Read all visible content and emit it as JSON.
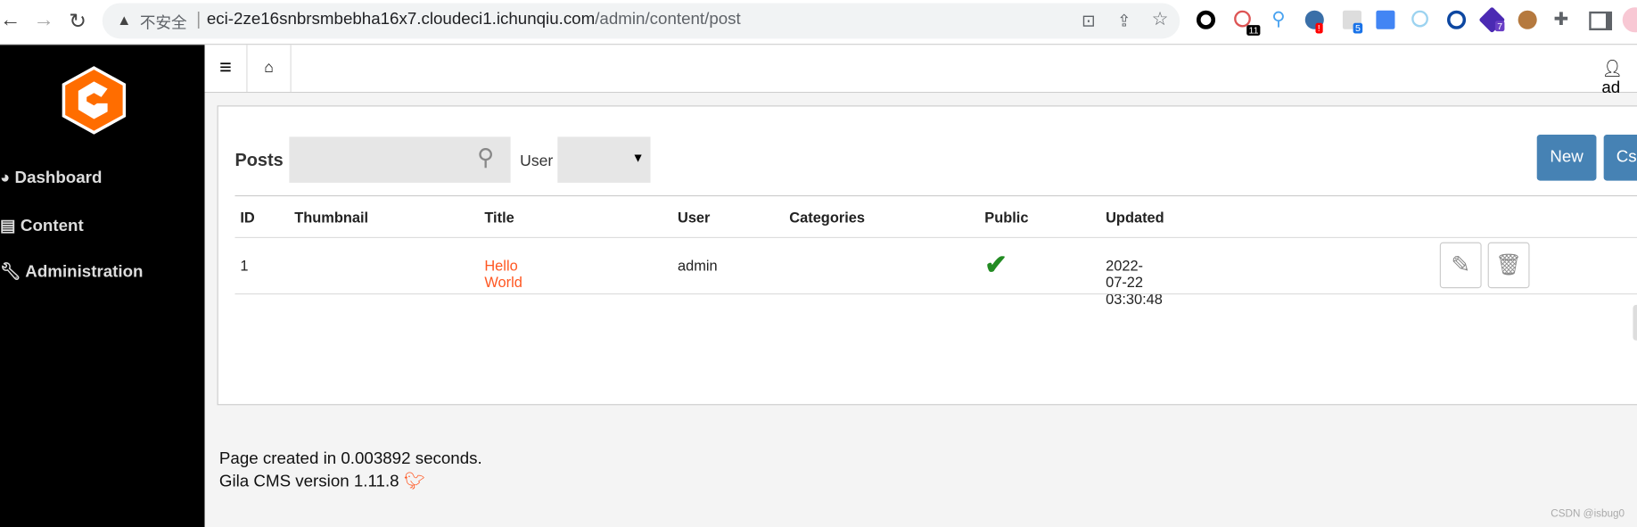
{
  "browser": {
    "security_label": "不安全",
    "url_host": "eci-2ze16snbrsmbebha16x7.cloudeci1.ichunqiu.com",
    "url_path": "/admin/content/post",
    "extension_badges": [
      "11",
      "!",
      "5",
      "7"
    ]
  },
  "sidebar": {
    "items": [
      {
        "label": "Dashboard",
        "icon": "dashboard-icon"
      },
      {
        "label": "Content",
        "icon": "newspaper-icon"
      },
      {
        "label": "Administration",
        "icon": "wrench-icon"
      }
    ]
  },
  "topbar": {
    "user": "ad"
  },
  "posts": {
    "title": "Posts",
    "search_placeholder": "",
    "user_filter_label": "User",
    "user_filter_value": "",
    "new_label": "New",
    "csv_label": "Cs",
    "columns": [
      "ID",
      "Thumbnail",
      "Title",
      "User",
      "Categories",
      "Public",
      "Updated"
    ],
    "rows": [
      {
        "id": "1",
        "thumbnail": "",
        "title": "Hello World",
        "user": "admin",
        "categories": "",
        "public": true,
        "updated": "2022-07-22 03:30:48"
      }
    ]
  },
  "footer": {
    "line1": "Page created in 0.003892 seconds.",
    "line2": "Gila CMS version 1.11.8"
  },
  "watermark": "CSDN @isbug0",
  "colors": {
    "accent": "#4682b4",
    "link": "#ff5722",
    "logo": "#ff6d00",
    "check": "#228b22"
  }
}
